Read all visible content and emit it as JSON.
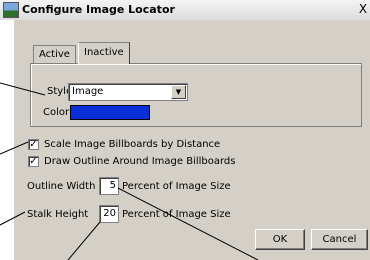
{
  "window": {
    "title": "Configure Image Locator",
    "close_glyph": "X"
  },
  "tabs": [
    {
      "label": "Active",
      "selected": false
    },
    {
      "label": "Inactive",
      "selected": true
    }
  ],
  "style_field": {
    "label": "Style",
    "value": "Image",
    "arrow_glyph": "▼"
  },
  "color_field": {
    "label": "Color",
    "swatch_color": "#0a2fd8"
  },
  "checkboxes": {
    "scale": {
      "label": "Scale Image Billboards by Distance",
      "checked": true,
      "glyph": "✓"
    },
    "outline": {
      "label": "Draw Outline Around Image Billboards",
      "checked": true,
      "glyph": "✓"
    }
  },
  "outline_width": {
    "label": "Outline Width",
    "value": "5",
    "suffix": "Percent of Image Size"
  },
  "stalk_height": {
    "label": "Stalk Height",
    "value": "20",
    "suffix": "Percent of Image Size"
  },
  "buttons": {
    "ok": "OK",
    "cancel": "Cancel"
  }
}
